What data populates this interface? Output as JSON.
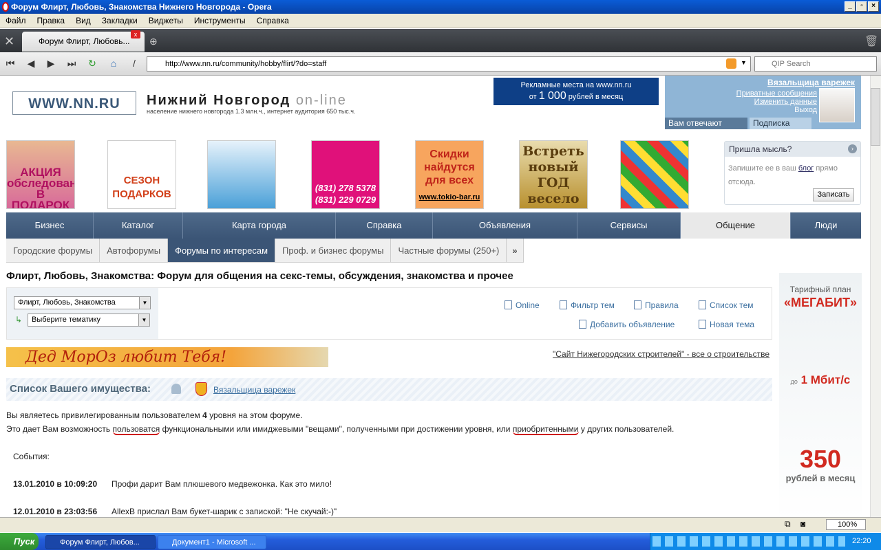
{
  "window": {
    "title": "Форум Флирт, Любовь, Знакомства Нижнего Новгорода - Opera"
  },
  "menu": [
    "Файл",
    "Правка",
    "Вид",
    "Закладки",
    "Виджеты",
    "Инструменты",
    "Справка"
  ],
  "tab": {
    "title": "Форум Флирт, Любовь..."
  },
  "address": {
    "url": "http://www.nn.ru/community/hobby/flirt/?do=staff",
    "search_placeholder": "QIP Search"
  },
  "header": {
    "logo": "WWW.NN.RU",
    "site_title": "Нижний Новгород",
    "site_title_suffix": "on-line",
    "subtitle": "население нижнего новгорода 1.3 млн.ч., интернет аудитория 650 тыс.ч.",
    "ad_line1": "Рекламные места на www.nn.ru",
    "ad_line2_prefix": "от",
    "ad_line2_amount": "1 000",
    "ad_line2_suffix": "рублей в месяц"
  },
  "user": {
    "name": "Вязальщица варежек",
    "links": [
      "Приватные сообщения",
      "Изменить данные",
      "Выход"
    ],
    "tab_active": "Вам отвечают",
    "tab_other": "Подписка"
  },
  "ads": {
    "t1": "АКЦИЯ обследование В ПОДАРОК",
    "t2": "СЕЗОН ПОДАРКОВ",
    "t4": "(831) 278 5378 (831) 229 0729",
    "t5": "Скидки найдутся для всех",
    "t5_link": "www.tokio-bar.ru",
    "t6": "Встреть новый ГОД весело"
  },
  "thought": {
    "title": "Пришла мысль?",
    "text_before": "Запишите ее в ваш",
    "link": "блог",
    "text_after": "прямо отсюда.",
    "button": "Записать"
  },
  "mainnav": [
    "Бизнес",
    "Каталог",
    "Карта города",
    "Справка",
    "Объявления",
    "Сервисы",
    "Общение",
    "Люди"
  ],
  "subnav": [
    "Городские форумы",
    "Автофорумы",
    "Форумы по интересам",
    "Проф. и бизнес форумы",
    "Частные форумы (250+)"
  ],
  "page_title": "Флирт, Любовь, Знакомства: Форум для общения на секс-темы, обсуждения, знакомства и прочее",
  "forum": {
    "select1": "Флирт, Любовь, Знакомства",
    "select2": "Выберите тематику",
    "links": {
      "online": "Online",
      "filter": "Фильтр тем",
      "rules": "Правила",
      "topics": "Список тем",
      "add_ad": "Добавить объявление",
      "new_topic": "Новая тема"
    }
  },
  "santa_banner": "Дед МорОз любит Тебя!",
  "builders_link": "\"Сайт Нижегородских строителей\" - все о строительстве",
  "list": {
    "title": "Список Вашего имущества:",
    "user_link": "Вязальщица варежек",
    "para1_a": "Вы являетесь привилегированным пользователем",
    "para1_level": "4",
    "para1_b": "уровня на этом форуме.",
    "para2_a": "Это дает Вам возможность",
    "para2_u1": "пользоватся",
    "para2_b": "функциональными или имиджевыми \"вещами\", полученными при достижении уровня, или",
    "para2_u2": "приобритенными",
    "para2_c": "у других пользователей.",
    "events_label": "События:",
    "events": [
      {
        "date": "13.01.2010 в 10:09:20",
        "text": "Профи дарит Вам плюшевого медвежонка. Как это мило!"
      },
      {
        "date": "12.01.2010 в 23:03:56",
        "text": "AllexB прислал Вам букет-шарик с запиской: \"Не скучай:-)\""
      }
    ]
  },
  "right_ad": {
    "plan": "Тарифный план",
    "name": "«МЕГАБИТ»",
    "speed_prefix": "до",
    "speed": "1 Мбит/с",
    "price": "350",
    "unit": "рублей в месяц"
  },
  "status": {
    "zoom": "100%"
  },
  "taskbar": {
    "start": "Пуск",
    "task1": "Форум Флирт, Любов...",
    "task2": "Документ1 - Microsoft ...",
    "clock": "22:20"
  },
  "colors": {
    "nav": "#3b5576",
    "accent_red": "#d12a20",
    "link": "#3b6fa0"
  }
}
